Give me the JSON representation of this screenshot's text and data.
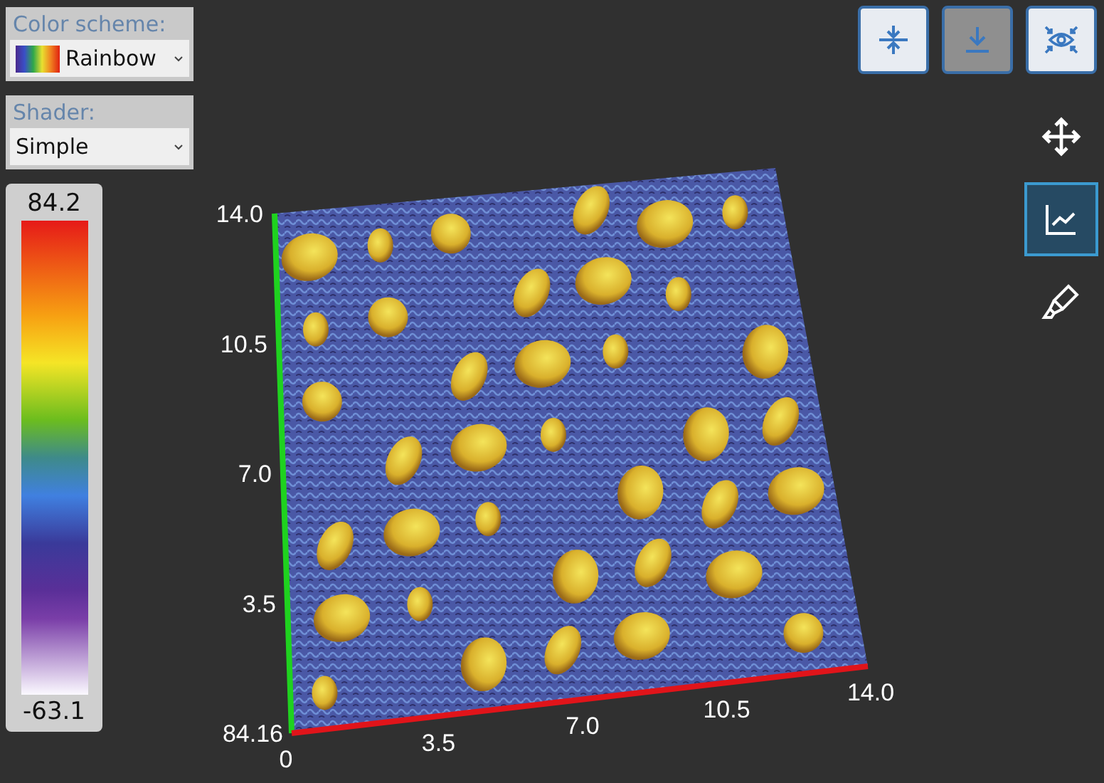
{
  "color_scheme": {
    "label": "Color scheme:",
    "value": "Rainbow"
  },
  "shader": {
    "label": "Shader:",
    "value": "Simple"
  },
  "legend": {
    "max": "84.2",
    "min": "-63.1"
  },
  "toolbar": [
    {
      "kind": "compress",
      "selected": false
    },
    {
      "kind": "download",
      "selected": true
    },
    {
      "kind": "focus",
      "selected": false
    }
  ],
  "tools": [
    {
      "kind": "move",
      "selected": false
    },
    {
      "kind": "chart",
      "selected": true
    },
    {
      "kind": "marker",
      "selected": false
    }
  ],
  "plot": {
    "corner_label": "84.16",
    "y_ticks": [
      "14.0",
      "10.5",
      "7.0",
      "3.5"
    ],
    "x_ticks": [
      "0",
      "3.5",
      "7.0",
      "10.5",
      "14.0"
    ]
  }
}
